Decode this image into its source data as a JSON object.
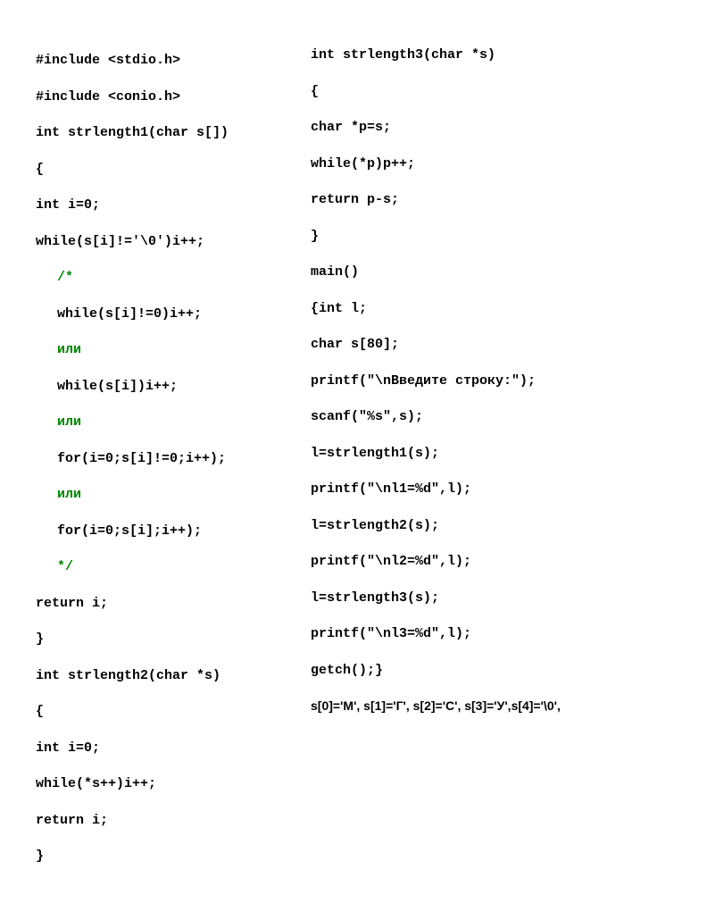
{
  "left": {
    "l01": "#include <stdio.h>",
    "l02": "#include <conio.h>",
    "l03": "int strlength1(char s[])",
    "l04": "{",
    "l05": "int i=0;",
    "l06": "while(s[i]!='\\0')i++;",
    "c01": "/*",
    "c02": "while(s[i]!=0)i++;",
    "c03": "или",
    "c04": "while(s[i])i++;",
    "c05": "или",
    "c06": "for(i=0;s[i]!=0;i++);",
    "c07": "или",
    "c08": "for(i=0;s[i];i++);",
    "c09": "*/",
    "l07": "return i;",
    "l08": "}",
    "l09": "int strlength2(char *s)",
    "l10": "{",
    "l11": "int i=0;",
    "l12": "while(*s++)i++;",
    "l13": "return i;",
    "l14": "}"
  },
  "right": {
    "r01": "int strlength3(char *s)",
    "r02": "{",
    "r03": "char *p=s;",
    "r04": "while(*p)p++;",
    "r05": "return p-s;",
    "r06": "}",
    "r07": "main()",
    "r08": "{int l;",
    "r09": "char s[80];",
    "r10": "printf(\"\\nВведите строку:\");",
    "r11": "scanf(\"%s\",s);",
    "r12": "l=strlength1(s);",
    "r13": "printf(\"\\nl1=%d\",l);",
    "r14": "l=strlength2(s);",
    "r15": "printf(\"\\nl2=%d\",l);",
    "r16": "l=strlength3(s);",
    "r17": "printf(\"\\nl3=%d\",l);",
    "r18": "getch();}",
    "footer": "s[0]='М', s[1]='Г', s[2]='С', s[3]='У',s[4]='\\0',"
  }
}
